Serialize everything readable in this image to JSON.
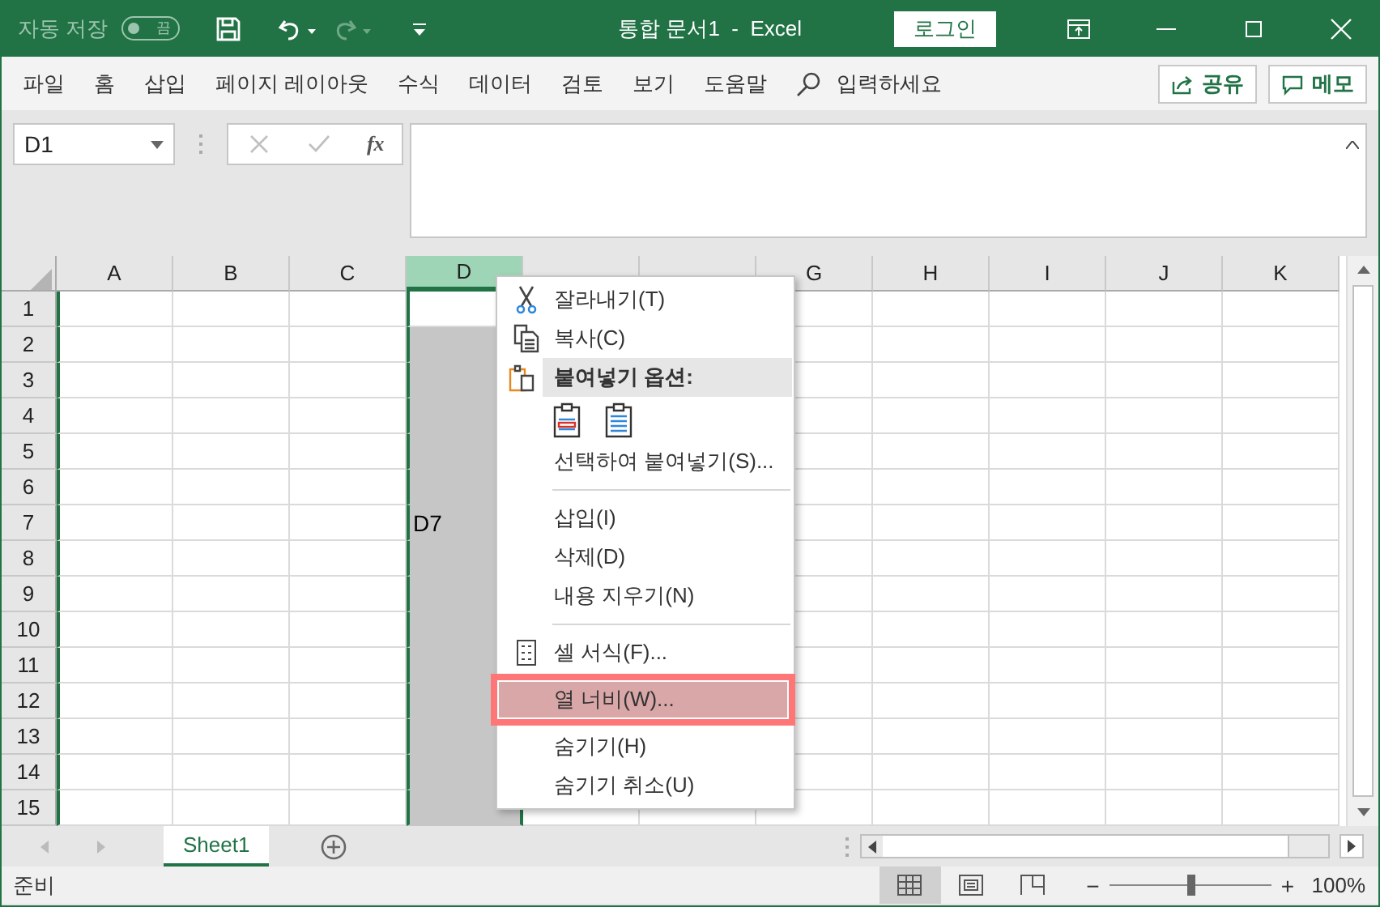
{
  "title_bar": {
    "autosave_label": "자동 저장",
    "autosave_toggle": {
      "on": false,
      "label": "끔"
    },
    "title": "통합 문서1  -  Excel",
    "login": "로그인"
  },
  "ribbon_tabs": [
    {
      "label": "파일"
    },
    {
      "label": "홈"
    },
    {
      "label": "삽입"
    },
    {
      "label": "페이지 레이아웃"
    },
    {
      "label": "수식"
    },
    {
      "label": "데이터"
    },
    {
      "label": "검토"
    },
    {
      "label": "보기"
    },
    {
      "label": "도움말"
    }
  ],
  "tell_me": {
    "placeholder": "입력하세요"
  },
  "share": "공유",
  "comments": "메모",
  "name_box": {
    "value": "D1"
  },
  "formula_bar": {
    "function_label": "fx"
  },
  "columns": [
    {
      "label": "A",
      "selected": false
    },
    {
      "label": "B",
      "selected": false
    },
    {
      "label": "C",
      "selected": false
    },
    {
      "label": "D",
      "selected": true
    },
    {
      "selected": false
    },
    {
      "selected": false
    },
    {
      "label": "G",
      "selected": false
    },
    {
      "label": "H",
      "selected": false
    },
    {
      "label": "I",
      "selected": false
    },
    {
      "label": "J",
      "selected": false
    },
    {
      "label": "K",
      "selected": false
    }
  ],
  "rows": [
    {
      "label": "1"
    },
    {
      "label": "2"
    },
    {
      "label": "3"
    },
    {
      "label": "4"
    },
    {
      "label": "5"
    },
    {
      "label": "6"
    },
    {
      "label": "7",
      "cells": [
        {
          "kind": "empty"
        },
        {
          "kind": "empty"
        },
        {
          "kind": "empty"
        },
        {
          "kind": "text",
          "text": "D7"
        }
      ]
    },
    {
      "label": "8"
    },
    {
      "label": "9"
    },
    {
      "label": "10"
    },
    {
      "label": "11"
    },
    {
      "label": "12"
    },
    {
      "label": "13"
    },
    {
      "label": "14"
    },
    {
      "label": "15"
    }
  ],
  "context_menu": [
    {
      "kind": "cut",
      "label": "잘라내기(T)",
      "selected": false
    },
    {
      "kind": "copy",
      "label": "복사(C)",
      "selected": false
    },
    {
      "kind": "paste_heading",
      "label": "붙여넣기 옵션:"
    },
    {
      "kind": "paste_buttons"
    },
    {
      "kind": "item",
      "label": "선택하여 붙여넣기(S)...",
      "selected": false
    },
    {
      "kind": "separator"
    },
    {
      "kind": "item",
      "label": "삽입(I)",
      "selected": false
    },
    {
      "kind": "item",
      "label": "삭제(D)",
      "selected": false
    },
    {
      "kind": "item",
      "label": "내용 지우기(N)",
      "selected": false
    },
    {
      "kind": "separator"
    },
    {
      "kind": "format",
      "label": "셀 서식(F)...",
      "selected": false
    },
    {
      "kind": "item",
      "label": "열 너비(W)...",
      "selected": true
    },
    {
      "kind": "item",
      "label": "숨기기(H)",
      "selected": false
    },
    {
      "kind": "item",
      "label": "숨기기 취소(U)",
      "selected": false
    }
  ],
  "sheet_tabs": [
    {
      "label": "Sheet1",
      "selected": true
    }
  ],
  "status_bar": {
    "status": "준비",
    "views": [
      {
        "kind": "normal",
        "selected": true
      },
      {
        "kind": "page_layout",
        "selected": false
      },
      {
        "kind": "page_break",
        "selected": false
      }
    ],
    "zoom_out": "−",
    "zoom_in": "+",
    "zoom": {
      "level": 0.5
    },
    "zoom_label": "100%"
  }
}
